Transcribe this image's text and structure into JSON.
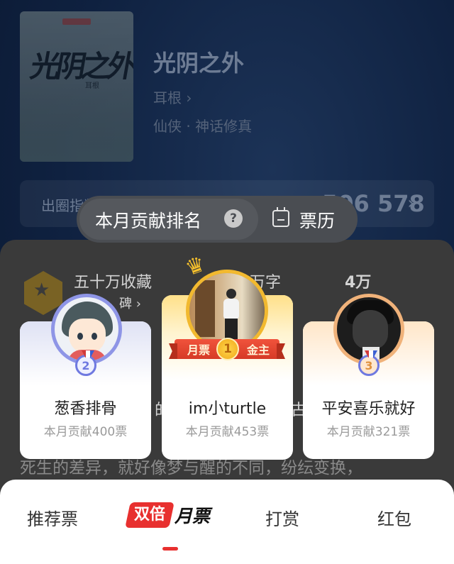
{
  "background": {
    "cover_title": "光阴之外",
    "cover_author": "耳根",
    "book_title": "光阴之外",
    "author": "耳根 ›",
    "genre": "仙侠 · 神话修真",
    "stat_label": "出圈指数",
    "stat_value": "506 578",
    "stat_chevron": "›",
    "sheet_items": [
      {
        "text": "五十万收藏"
      },
      {
        "text": "碑 ›"
      },
      {
        "text": "万字"
      },
      {
        "text": "4万"
      },
      {
        "text": "的"
      },
      {
        "text": "古"
      },
      {
        "text": "死生的差异，就好像梦与醒的不同，纷纭变换，"
      }
    ]
  },
  "tabs": {
    "rank_label": "本月贡献排名",
    "help_icon": "?",
    "history_label": "票历"
  },
  "contributors": [
    {
      "rank": "2",
      "name": "葱香排骨",
      "votes": "本月贡献400票"
    },
    {
      "rank": "1",
      "name": "im小turtle",
      "votes": "本月贡献453票",
      "ribbon_left": "月票",
      "ribbon_right": "金主"
    },
    {
      "rank": "3",
      "name": "平安喜乐就好",
      "votes": "本月贡献321票"
    }
  ],
  "bottom_tabs": {
    "recommend": "推荐票",
    "double_badge": "双倍",
    "monthly": "月票",
    "tip": "打赏",
    "red_packet": "红包"
  },
  "colors": {
    "accent_red": "#e8302f",
    "gold": "#f2b92f",
    "silver_ring": "#8e95e6",
    "bronze_ring": "#f0b27a"
  }
}
